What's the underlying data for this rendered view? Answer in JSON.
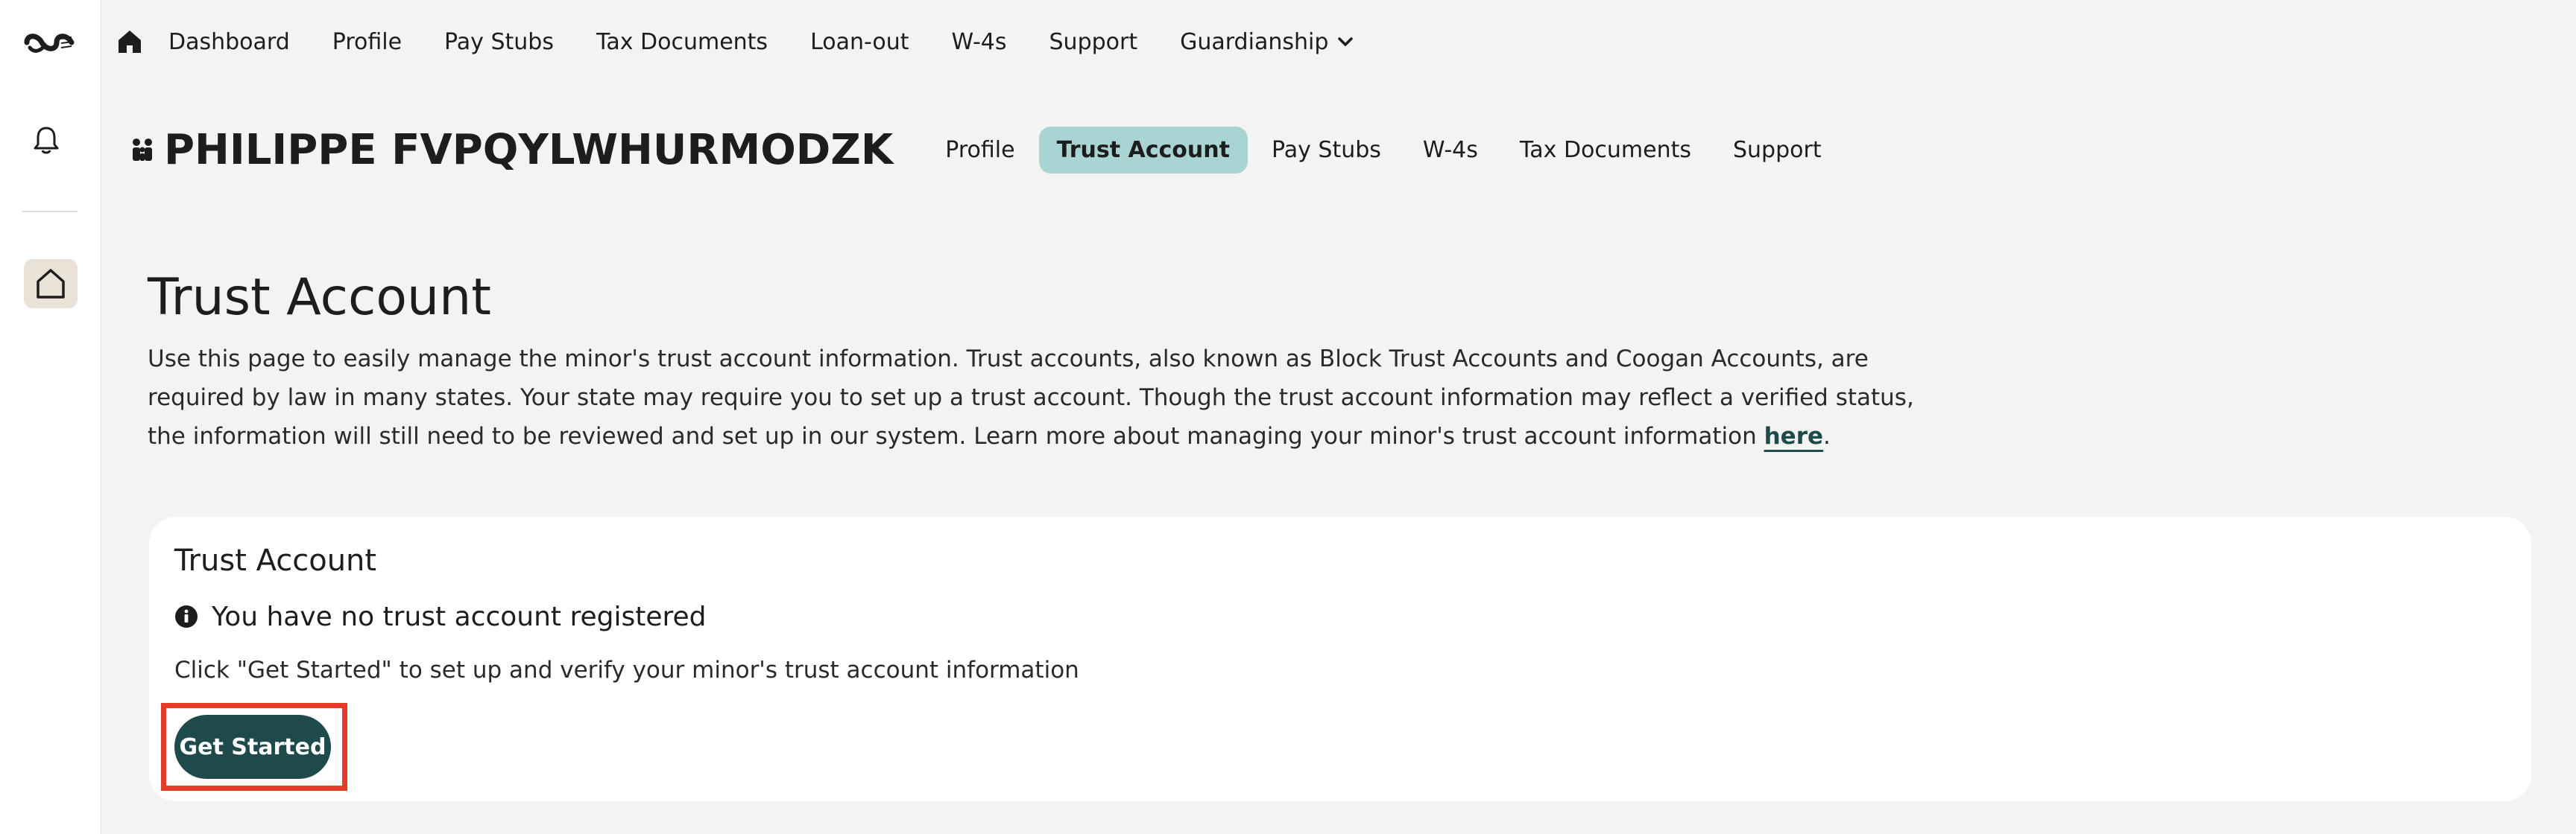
{
  "top_nav": {
    "items": [
      "Dashboard",
      "Profile",
      "Pay Stubs",
      "Tax Documents",
      "Loan-out",
      "W-4s",
      "Support"
    ],
    "dropdown_label": "Guardianship"
  },
  "sub_header": {
    "person_name": "PHILIPPE FVPQYLWHURMODZK",
    "tabs": [
      {
        "label": "Profile",
        "active": false
      },
      {
        "label": "Trust Account",
        "active": true
      },
      {
        "label": "Pay Stubs",
        "active": false
      },
      {
        "label": "W-4s",
        "active": false
      },
      {
        "label": "Tax Documents",
        "active": false
      },
      {
        "label": "Support",
        "active": false
      }
    ]
  },
  "page": {
    "title": "Trust Account",
    "intro_text": "Use this page to easily manage the minor's trust account information. Trust accounts, also known as Block Trust Accounts and Coogan Accounts, are required by law in many states. Your state may require you to set up a trust account. Though the trust account information may reflect a verified status, the information will still need to be reviewed and set up in our system. Learn more about managing your minor's trust account information ",
    "intro_link": "here",
    "intro_end": "."
  },
  "card": {
    "title": "Trust Account",
    "status": "You have no trust account registered",
    "description": "Click \"Get Started\" to set up and verify your minor's trust account information",
    "button_label": "Get Started"
  },
  "colors": {
    "accent_teal": "#1e4a4b",
    "active_tab": "#a8d4d4",
    "highlight_frame": "#e63b26",
    "background": "#f3f3f2"
  }
}
